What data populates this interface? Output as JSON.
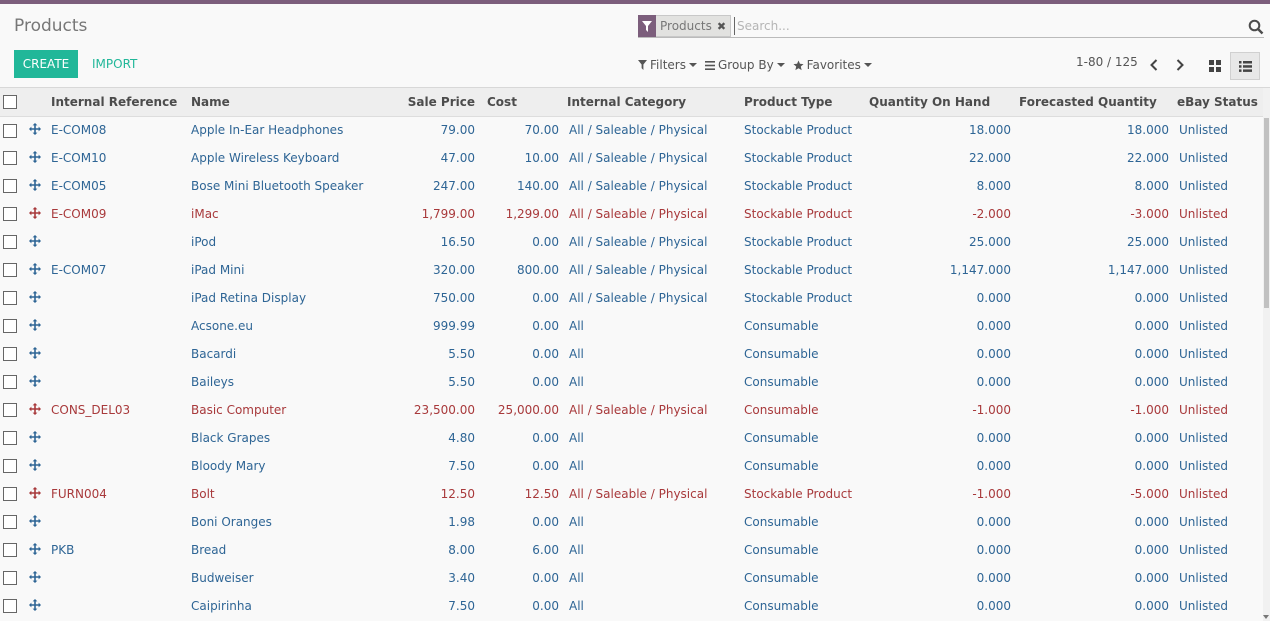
{
  "app": {
    "title": "Products"
  },
  "buttons": {
    "create": "CREATE",
    "import": "IMPORT"
  },
  "search": {
    "facet_label": "Products",
    "placeholder": "Search..."
  },
  "filters": {
    "filters": "Filters",
    "group_by": "Group By",
    "favorites": "Favorites"
  },
  "pager": {
    "text": "1-80 / 125"
  },
  "colors": {
    "accent": "#21b799",
    "brand": "#7c5e7c",
    "link": "#2e6595",
    "warning": "#a8393b"
  },
  "table": {
    "headers": [
      "Internal Reference",
      "Name",
      "Sale Price",
      "Cost",
      "Internal Category",
      "Product Type",
      "Quantity On Hand",
      "Forecasted Quantity",
      "eBay Status"
    ],
    "rows": [
      {
        "ref": "E-COM08",
        "name": "Apple In-Ear Headphones",
        "sale": "79.00",
        "cost": "70.00",
        "cat": "All / Saleable / Physical",
        "type": "Stockable Product",
        "qty": "18.000",
        "fq": "18.000",
        "ebay": "Unlisted",
        "warn": false
      },
      {
        "ref": "E-COM10",
        "name": "Apple Wireless Keyboard",
        "sale": "47.00",
        "cost": "10.00",
        "cat": "All / Saleable / Physical",
        "type": "Stockable Product",
        "qty": "22.000",
        "fq": "22.000",
        "ebay": "Unlisted",
        "warn": false
      },
      {
        "ref": "E-COM05",
        "name": "Bose Mini Bluetooth Speaker",
        "sale": "247.00",
        "cost": "140.00",
        "cat": "All / Saleable / Physical",
        "type": "Stockable Product",
        "qty": "8.000",
        "fq": "8.000",
        "ebay": "Unlisted",
        "warn": false
      },
      {
        "ref": "E-COM09",
        "name": "iMac",
        "sale": "1,799.00",
        "cost": "1,299.00",
        "cat": "All / Saleable / Physical",
        "type": "Stockable Product",
        "qty": "-2.000",
        "fq": "-3.000",
        "ebay": "Unlisted",
        "warn": true
      },
      {
        "ref": "",
        "name": "iPod",
        "sale": "16.50",
        "cost": "0.00",
        "cat": "All / Saleable / Physical",
        "type": "Stockable Product",
        "qty": "25.000",
        "fq": "25.000",
        "ebay": "Unlisted",
        "warn": false
      },
      {
        "ref": "E-COM07",
        "name": "iPad Mini",
        "sale": "320.00",
        "cost": "800.00",
        "cat": "All / Saleable / Physical",
        "type": "Stockable Product",
        "qty": "1,147.000",
        "fq": "1,147.000",
        "ebay": "Unlisted",
        "warn": false
      },
      {
        "ref": "",
        "name": "iPad Retina Display",
        "sale": "750.00",
        "cost": "0.00",
        "cat": "All / Saleable / Physical",
        "type": "Stockable Product",
        "qty": "0.000",
        "fq": "0.000",
        "ebay": "Unlisted",
        "warn": false
      },
      {
        "ref": "",
        "name": "Acsone.eu",
        "sale": "999.99",
        "cost": "0.00",
        "cat": "All",
        "type": "Consumable",
        "qty": "0.000",
        "fq": "0.000",
        "ebay": "Unlisted",
        "warn": false
      },
      {
        "ref": "",
        "name": "Bacardi",
        "sale": "5.50",
        "cost": "0.00",
        "cat": "All",
        "type": "Consumable",
        "qty": "0.000",
        "fq": "0.000",
        "ebay": "Unlisted",
        "warn": false
      },
      {
        "ref": "",
        "name": "Baileys",
        "sale": "5.50",
        "cost": "0.00",
        "cat": "All",
        "type": "Consumable",
        "qty": "0.000",
        "fq": "0.000",
        "ebay": "Unlisted",
        "warn": false
      },
      {
        "ref": "CONS_DEL03",
        "name": "Basic Computer",
        "sale": "23,500.00",
        "cost": "25,000.00",
        "cat": "All / Saleable / Physical",
        "type": "Consumable",
        "qty": "-1.000",
        "fq": "-1.000",
        "ebay": "Unlisted",
        "warn": true
      },
      {
        "ref": "",
        "name": "Black Grapes",
        "sale": "4.80",
        "cost": "0.00",
        "cat": "All",
        "type": "Consumable",
        "qty": "0.000",
        "fq": "0.000",
        "ebay": "Unlisted",
        "warn": false
      },
      {
        "ref": "",
        "name": "Bloody Mary",
        "sale": "7.50",
        "cost": "0.00",
        "cat": "All",
        "type": "Consumable",
        "qty": "0.000",
        "fq": "0.000",
        "ebay": "Unlisted",
        "warn": false
      },
      {
        "ref": "FURN004",
        "name": "Bolt",
        "sale": "12.50",
        "cost": "12.50",
        "cat": "All / Saleable / Physical",
        "type": "Stockable Product",
        "qty": "-1.000",
        "fq": "-5.000",
        "ebay": "Unlisted",
        "warn": true
      },
      {
        "ref": "",
        "name": "Boni Oranges",
        "sale": "1.98",
        "cost": "0.00",
        "cat": "All",
        "type": "Consumable",
        "qty": "0.000",
        "fq": "0.000",
        "ebay": "Unlisted",
        "warn": false
      },
      {
        "ref": "PKB",
        "name": "Bread",
        "sale": "8.00",
        "cost": "6.00",
        "cat": "All",
        "type": "Consumable",
        "qty": "0.000",
        "fq": "0.000",
        "ebay": "Unlisted",
        "warn": false
      },
      {
        "ref": "",
        "name": "Budweiser",
        "sale": "3.40",
        "cost": "0.00",
        "cat": "All",
        "type": "Consumable",
        "qty": "0.000",
        "fq": "0.000",
        "ebay": "Unlisted",
        "warn": false
      },
      {
        "ref": "",
        "name": "Caipirinha",
        "sale": "7.50",
        "cost": "0.00",
        "cat": "All",
        "type": "Consumable",
        "qty": "0.000",
        "fq": "0.000",
        "ebay": "Unlisted",
        "warn": false
      }
    ]
  }
}
